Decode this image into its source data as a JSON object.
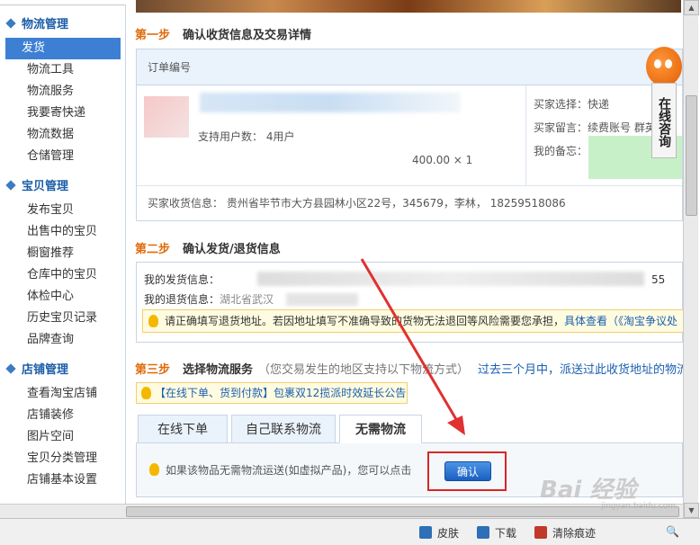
{
  "sidebar": {
    "sections": [
      {
        "title": "物流管理",
        "items": [
          "发货",
          "物流工具",
          "物流服务",
          "我要寄快递",
          "物流数据",
          "仓储管理"
        ]
      },
      {
        "title": "宝贝管理",
        "items": [
          "发布宝贝",
          "出售中的宝贝",
          "橱窗推荐",
          "仓库中的宝贝",
          "体检中心",
          "历史宝贝记录",
          "品牌查询"
        ]
      },
      {
        "title": "店铺管理",
        "items": [
          "查看淘宝店铺",
          "店铺装修",
          "图片空间",
          "宝贝分类管理",
          "店铺基本设置"
        ]
      }
    ],
    "active_item": "发货"
  },
  "step1": {
    "num": "第一步",
    "title": "确认收货信息及交易详情",
    "order_label": "订单编号",
    "users_text": "支持用户数：  4用户",
    "price_qty": "400.00 × 1",
    "buyer_choice": "买家选择：快递",
    "buyer_msg": "买家留言：续费账号  群英",
    "my_memo": "我的备忘：",
    "receiver": "买家收货信息：  贵州省毕节市大方县园林小区22号，345679，李林，  18259518086"
  },
  "step2": {
    "num": "第二步",
    "title": "确认发货/退货信息",
    "ship_label": "我的发货信息：",
    "ship_tail": "55",
    "return_label": "我的退货信息：",
    "return_value": "湖北省武汉",
    "warning": "请正确填写退货地址。若因地址填写不准确导致的货物无法退回等风险需要您承担，",
    "warning_link": "具体查看（《淘宝争议处"
  },
  "step3": {
    "num": "第三步",
    "title": "选择物流服务",
    "note": "（您交易发生的地区支持以下物流方式）",
    "link": "过去三个月中，派送过此收货地址的物流公司列",
    "promo": "【在线下单、货到付款】包裹双12揽派时效延长公告",
    "tabs": [
      "在线下单",
      "自己联系物流",
      "无需物流"
    ],
    "active_tab": "无需物流",
    "panel_text": "如果该物品无需物流运送(如虚拟产品)，您可以点击",
    "confirm_label": "确认"
  },
  "float_chat": {
    "label": "在线咨询"
  },
  "statusbar": {
    "skin": "皮肤",
    "download": "下载",
    "clear_history": "清除痕迹"
  },
  "watermark": {
    "main": "Bai 经验",
    "sub": "jingyan.baidu.com"
  },
  "colors": {
    "accent": "#3d7fd3",
    "step_num": "#e06a0a",
    "highlight_box": "#d92626"
  }
}
